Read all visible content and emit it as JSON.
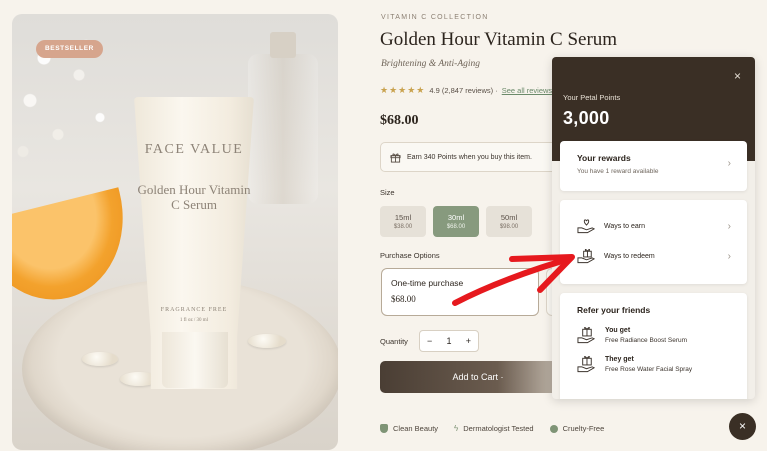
{
  "product_image": {
    "badge": "BESTSELLER",
    "tube_brand": "FACE VALUE",
    "tube_name": "Golden Hour Vitamin C Serum",
    "tube_free": "FRAGRANCE FREE",
    "tube_size": "1 fl oz / 30 ml"
  },
  "product": {
    "collection": "VITAMIN C COLLECTION",
    "title": "Golden Hour Vitamin C Serum",
    "subtitle": "Brightening & Anti-Aging",
    "stars": "★★★★★",
    "rating_text": "4.9 (2,847 reviews) ·",
    "reviews_link": "See all reviews",
    "price": "$68.00",
    "earn_text": "Earn 340 Points when you buy this item."
  },
  "size": {
    "label": "Size",
    "options": [
      {
        "size": "15ml",
        "price": "$38.00"
      },
      {
        "size": "30ml",
        "price": "$68.00"
      },
      {
        "size": "50ml",
        "price": "$98.00"
      }
    ],
    "selected": "30ml"
  },
  "purchase": {
    "label": "Purchase Options",
    "option_title": "One-time purchase",
    "option_price": "$68.00"
  },
  "quantity": {
    "label": "Quantity",
    "minus": "−",
    "value": "1",
    "plus": "+"
  },
  "add_to_cart": "Add to Cart ·",
  "features": [
    "Clean Beauty",
    "Dermatologist Tested",
    "Cruelty-Free"
  ],
  "rewards_panel": {
    "close": "×",
    "points_label": "Your Petal Points",
    "points_value": "3,000",
    "rewards_title": "Your rewards",
    "rewards_subtitle": "You have 1 reward available",
    "ways_to_earn": "Ways to earn",
    "ways_to_redeem": "Ways to redeem",
    "refer_title": "Refer your friends",
    "you_get_label": "You get",
    "you_get_value": "Free Radiance Boost Serum",
    "they_get_label": "They get",
    "they_get_value": "Free Rose Water Facial Spray",
    "chevron": "›"
  },
  "fab_icon": "×",
  "colors": {
    "accent_green": "#879a7e",
    "dark_brown": "#3a2f25",
    "annotation_red": "#e6191e"
  },
  "icons": [
    "gift-icon",
    "heart-hand-icon",
    "close-icon",
    "chevron-right-icon",
    "shield-icon"
  ]
}
